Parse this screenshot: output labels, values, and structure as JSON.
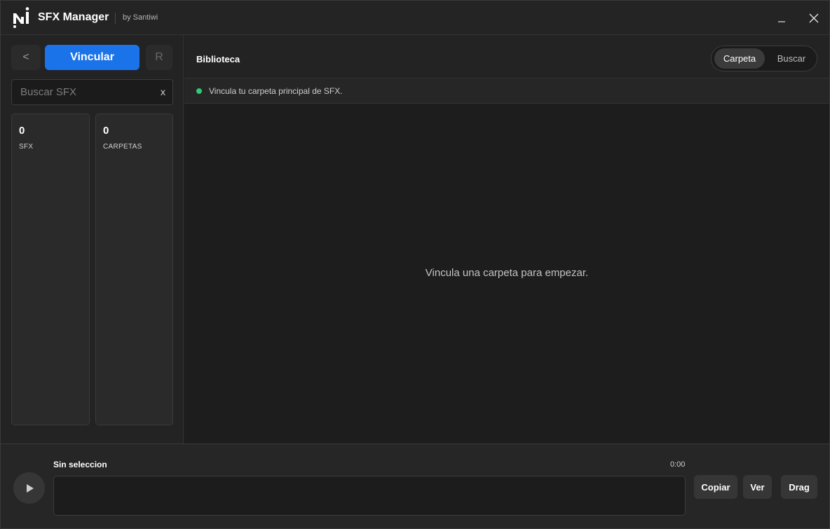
{
  "app": {
    "title": "SFX Manager",
    "subtitle": "by Santiwi"
  },
  "window_controls": {
    "minimize_icon": "minimize-icon",
    "close_icon": "close-icon"
  },
  "sidebar": {
    "back_label": "<",
    "link_label": "Vincular",
    "refresh_label": "R",
    "search": {
      "placeholder": "Buscar SFX",
      "value": "",
      "clear_label": "x"
    },
    "stats": [
      {
        "value": "0",
        "label": "SFX"
      },
      {
        "value": "0",
        "label": "CARPETAS"
      }
    ]
  },
  "main": {
    "title": "Biblioteca",
    "view_toggle": {
      "options": [
        "Carpeta",
        "Buscar"
      ],
      "selected": "Carpeta"
    },
    "status": {
      "indicator_color": "#2ecc71",
      "text": "Vincula tu carpeta principal de SFX."
    },
    "empty_message": "Vincula una carpeta para empezar."
  },
  "player": {
    "play_icon": "play-icon",
    "selection_title": "Sin seleccion",
    "time": "0:00",
    "buttons": {
      "copy": "Copiar",
      "view": "Ver",
      "drag": "Drag"
    }
  },
  "colors": {
    "accent": "#1a73e8",
    "status_ok": "#2ecc71"
  }
}
